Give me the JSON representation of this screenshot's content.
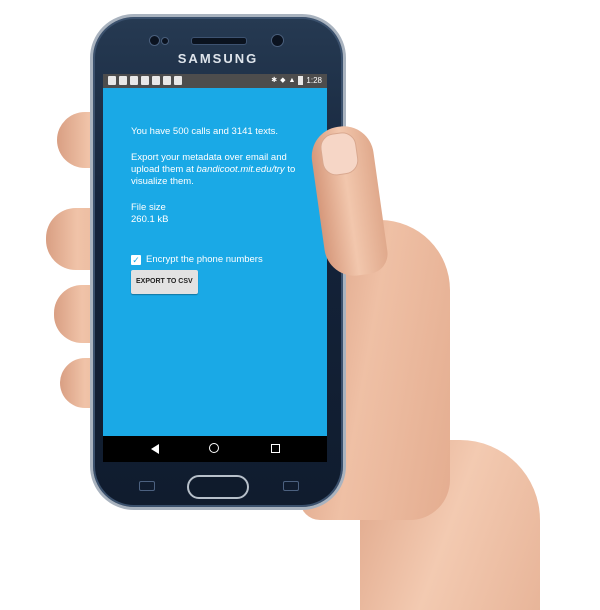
{
  "device": {
    "brand": "SAMSUNG",
    "status_time": "1:28"
  },
  "app": {
    "summary": "You have 500 calls and 3141 texts.",
    "export_text_before": "Export your metadata over email and upload them at ",
    "export_link": "bandicoot.mit.edu/try",
    "export_text_after": " to visualize them.",
    "file_size_label": "File size",
    "file_size_value": "260.1 kB",
    "encrypt_label": "Encrypt the phone numbers",
    "encrypt_checked": true,
    "export_button": "EXPORT TO CSV"
  },
  "icons": {
    "checkbox_mark": "✓",
    "status_bluetooth": "✱",
    "status_wifi": "◆",
    "status_signal": "▲"
  },
  "colors": {
    "screen_background": "#1aa9e6",
    "status_bar": "#4d4d4d",
    "navigation_bar": "#000000"
  }
}
